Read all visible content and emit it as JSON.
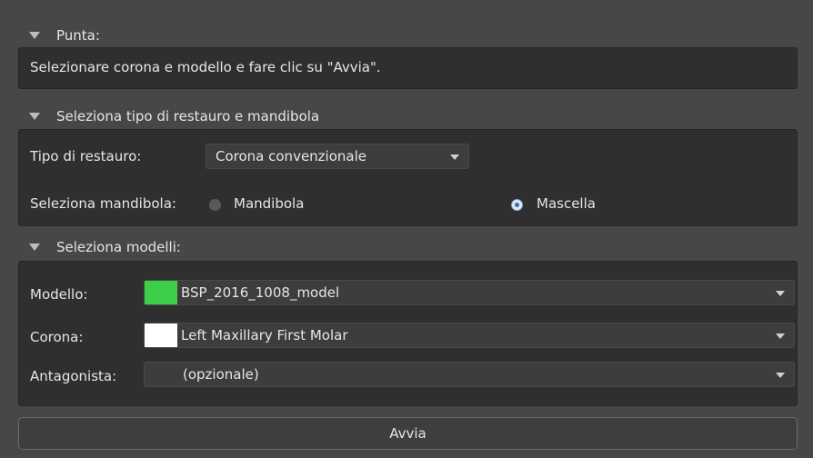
{
  "sections": {
    "tip": {
      "title": "Punta:",
      "text": "Selezionare corona e modello e fare clic su \"Avvia\"."
    },
    "restoration": {
      "title": "Seleziona tipo di restauro e mandibola",
      "type_label": "Tipo di restauro:",
      "type_value": "Corona convenzionale",
      "jaw_label": "Seleziona mandibola:",
      "jaw_options": [
        "Mandibola",
        "Mascella"
      ],
      "jaw_selected": "Mascella"
    },
    "models": {
      "title": "Seleziona modelli:",
      "rows": [
        {
          "label": "Modello:",
          "value": "BSP_2016_1008_model",
          "swatch": "#3ecf4a"
        },
        {
          "label": "Corona:",
          "value": "Left Maxillary First Molar",
          "swatch": "#ffffff"
        },
        {
          "label": "Antagonista:",
          "value": "(opzionale)",
          "swatch": ""
        }
      ]
    }
  },
  "start_button": "Avvia",
  "colors": {
    "background": "#474747",
    "panel": "#2f2f2f",
    "radio_selected": "#2f6fb8"
  }
}
